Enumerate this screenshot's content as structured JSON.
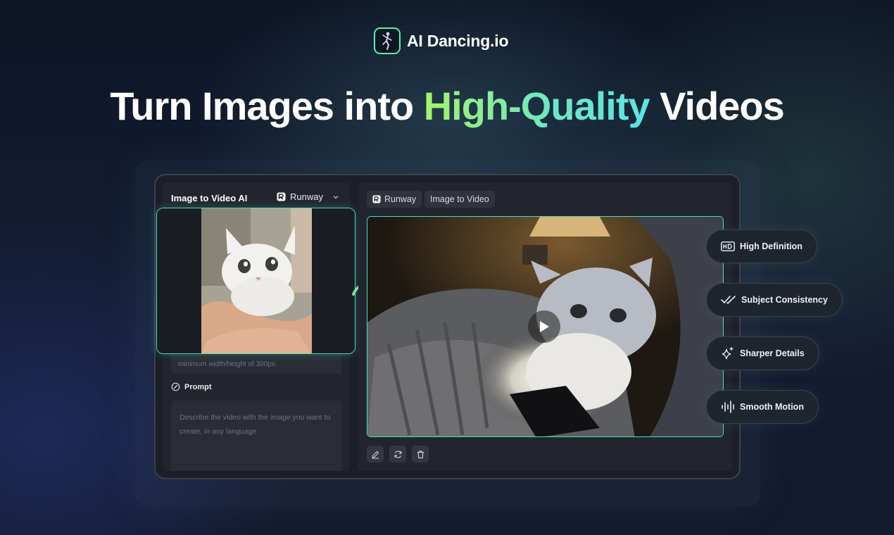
{
  "brand": {
    "name": "AI Dancing.io"
  },
  "headline": {
    "before": "Turn Images into ",
    "highlight": "High-Quality",
    "after": " Videos"
  },
  "left_panel": {
    "title": "Image to Video AI",
    "model": "Runway",
    "upload_hint": "minimum width/height of 300px.",
    "prompt_label": "Prompt",
    "prompt_placeholder": "Describe the video with the image you want to create, in any language"
  },
  "right_panel": {
    "model_chip": "Runway",
    "mode_chip": "Image to Video"
  },
  "features": [
    {
      "label": "High Definition",
      "icon": "hd-icon"
    },
    {
      "label": "Subject Consistency",
      "icon": "double-check-icon"
    },
    {
      "label": "Sharper Details",
      "icon": "sparkle-icon"
    },
    {
      "label": "Smooth Motion",
      "icon": "waveform-icon"
    }
  ],
  "colors": {
    "accent": "#43e0bf",
    "highlight_start": "#a4f56a",
    "highlight_end": "#5ce3e6"
  }
}
